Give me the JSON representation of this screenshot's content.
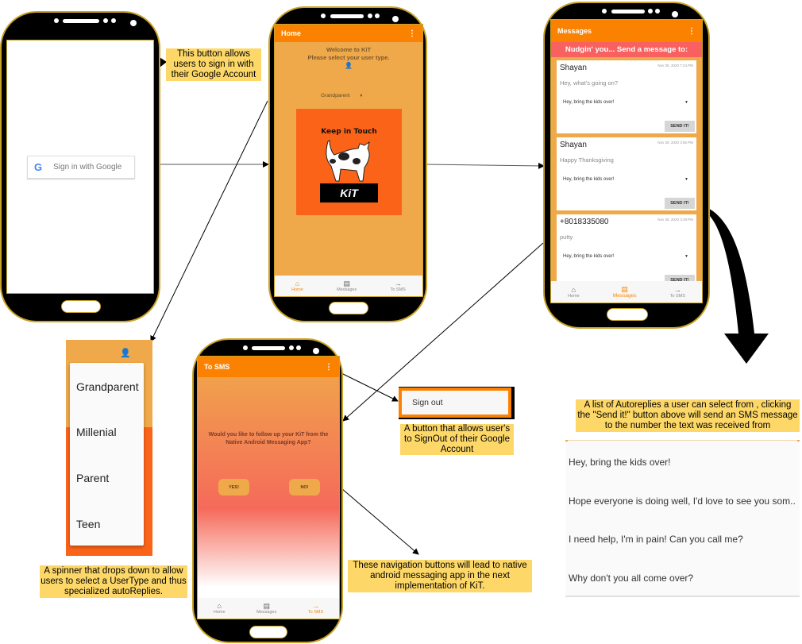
{
  "login_screen": {
    "google_button_label": "Sign in with Google",
    "google_icon": "G"
  },
  "home_screen": {
    "appbar_title": "Home",
    "menu_icon": "⋮",
    "welcome_line1": "Welcome to KiT",
    "welcome_line2": "Please select your user type.",
    "spinner_value": "Grandparent",
    "logo_tagline": "Keep in Touch",
    "logo_brand": "KiT",
    "nav": [
      {
        "label": "Home",
        "icon": "⌂"
      },
      {
        "label": "Messages",
        "icon": "▤"
      },
      {
        "label": "To SMS",
        "icon": "→"
      }
    ]
  },
  "messages_screen": {
    "appbar_title": "Messages",
    "menu_icon": "⋮",
    "banner": "Nudgin' you... Send a message to:",
    "cards": [
      {
        "sender": "Shayan",
        "time": "Nov 30, 2020 7:24 PM",
        "body": "Hey, what's going on?",
        "reply": "Hey, bring the kids over!",
        "send_label": "SEND IT!"
      },
      {
        "sender": "Shayan",
        "time": "Nov 30, 2020 3:56 PM",
        "body": "Happy Thanksgiving",
        "reply": "Hey, bring the kids over!",
        "send_label": "SEND IT!"
      },
      {
        "sender": "+8018335080",
        "time": "Nov 30, 2020 3:29 PM",
        "body": "putty",
        "reply": "Hey, bring the kids over!",
        "send_label": "SEND IT!"
      }
    ],
    "nav": [
      {
        "label": "Home",
        "icon": "⌂"
      },
      {
        "label": "Messages",
        "icon": "▤"
      },
      {
        "label": "To SMS",
        "icon": "→"
      }
    ]
  },
  "spinner_dropdown": {
    "options": [
      "Grandparent",
      "Millenial",
      "Parent",
      "Teen"
    ]
  },
  "tosms_screen": {
    "appbar_title": "To SMS",
    "menu_icon": "⋮",
    "question": "Would you like to follow up your KiT from the Native Android Messaging App?",
    "yes_label": "YES!",
    "no_label": "NO!",
    "nav": [
      {
        "label": "Home",
        "icon": "⌂"
      },
      {
        "label": "Messages",
        "icon": "▤"
      },
      {
        "label": "To SMS",
        "icon": "→"
      }
    ]
  },
  "signout_menu": {
    "label": "Sign out"
  },
  "autoreplies_list": {
    "items": [
      "Hey, bring the kids over!",
      "Hope everyone is doing well, I'd love to see you som..",
      "I need help, I'm in pain! Can you call me?",
      "Why don't you all come over?"
    ]
  },
  "callouts": {
    "google_signin": "This button allows users to sign in with their Google Account",
    "signout": "A button that allows user's to SignOut of their Google Account",
    "spinner": "A spinner that drops down to allow users to select a UserType and thus specialized autoReplies.",
    "navigation": "These navigation buttons will lead to native android messaging app in the next implementation of KiT.",
    "autoreplies": "A list of Autoreplies a user can select from , clicking the \"Send it!\" button above will send an SMS message to the number the text was received from"
  },
  "colors": {
    "accent": "#fb8200",
    "home_bg": "#f0a94a",
    "banner": "#f96060",
    "callout": "#fdd869"
  }
}
